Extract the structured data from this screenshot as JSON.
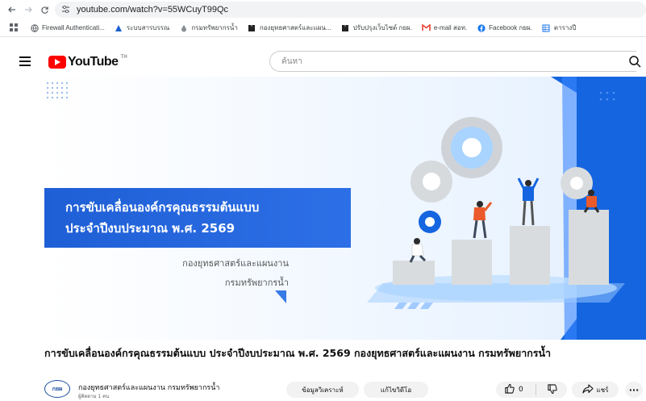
{
  "browser": {
    "url": "youtube.com/watch?v=55WCuyT99Qc",
    "site_info_icon": "tune-icon",
    "bookmarks": [
      {
        "label": "Firewall Authenticati...",
        "icon": "globe-icon"
      },
      {
        "label": "ระบบสารบรรณ",
        "icon": "triangle-logo-icon"
      },
      {
        "label": "กรมทรัพยากรน้ำ",
        "icon": "drop-icon"
      },
      {
        "label": "กองยุทธศาสตร์และแผน...",
        "icon": "ms-logo-icon"
      },
      {
        "label": "ปรับปรุงเว็บไซต์ กยผ.",
        "icon": "ms-logo-icon"
      },
      {
        "label": "e-mail สอท.",
        "icon": "gmail-icon"
      },
      {
        "label": "Facebook กยผ.",
        "icon": "facebook-icon"
      },
      {
        "label": "ตารางปี",
        "icon": "sheet-icon"
      }
    ]
  },
  "youtube": {
    "logo_text": "YouTube",
    "logo_region": "TH",
    "search_placeholder": "ค้นหา"
  },
  "video": {
    "banner_line1": "การขับเคลื่อนองค์กรคุณธรรมต้นแบบ",
    "banner_line2": "ประจำปีงบประมาณ พ.ศ. 2569",
    "org_line1": "กองยุทธศาสตร์และแผนงาน",
    "org_line2": "กรมทรัพยากรน้ำ",
    "title": "การขับเคลื่อนองค์กรคุณธรรมต้นแบบ ประจำปีงบประมาณ พ.ศ. 2569 กองยุทธศาสตร์และแผนงาน กรมทรัพยากรน้ำ"
  },
  "channel": {
    "avatar_text": "กยผ",
    "name": "กองยุทธศาสตร์และแผนงาน กรมทรัพยากรน้ำ",
    "subscribers": "ผู้ติดตาม 1 คน",
    "analytics_label": "ข้อมูลวิเคราะห์",
    "edit_label": "แก้ไขวิดีโอ",
    "like_count": "0",
    "share_label": "แชร์"
  },
  "colors": {
    "brand_red": "#ff0000",
    "banner_blue": "#1f5fd6",
    "accent_blue": "#1565e0",
    "figure_orange": "#ea5a2a"
  }
}
